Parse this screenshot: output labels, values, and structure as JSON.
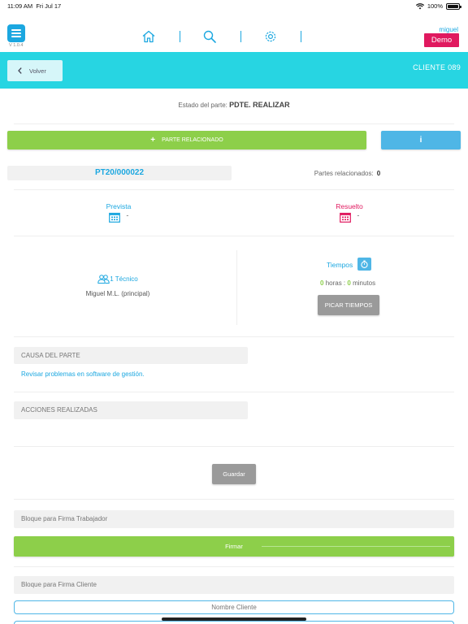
{
  "status_bar": {
    "time": "11:09 AM",
    "date": "Fri Jul 17",
    "battery": "100%"
  },
  "app": {
    "version": "V 1.0.4",
    "user": "miguel",
    "company_badge": "Demo"
  },
  "nav": {
    "icons": [
      "home-icon",
      "search-icon",
      "gear-icon"
    ]
  },
  "header": {
    "back_label": "Volver",
    "client": "CLIENTE 089"
  },
  "estado": {
    "label": "Estado del parte:",
    "value": "PDTE. REALIZAR"
  },
  "actions": {
    "parte_relacionado": "PARTE RELACIONADO",
    "info": "i"
  },
  "parte": {
    "code": "PT20/000022",
    "relacionados_label": "Partes relacionados:",
    "relacionados_count": "0"
  },
  "fechas": {
    "prevista": {
      "label": "Prevista",
      "value": "-"
    },
    "resuelto": {
      "label": "Resuelto",
      "value": "-"
    }
  },
  "tecnicos": {
    "label": "1 Técnico",
    "name": "Miguel M.L. (principal)"
  },
  "tiempos": {
    "label": "Tiempos",
    "horas": "0",
    "horas_label": "horas :",
    "minutos": "0",
    "minutos_label": "minutos",
    "picar": "PICAR TIEMPOS"
  },
  "causa": {
    "label": "CAUSA DEL PARTE",
    "text": "Revisar problemas en software de gestión."
  },
  "acciones": {
    "label": "ACCIONES REALIZADAS"
  },
  "guardar": "Guardar",
  "firma_trabajador": {
    "label": "Bloque para Firma Trabajador",
    "button": "Firmar"
  },
  "firma_cliente": {
    "label": "Bloque para Firma Cliente",
    "placeholder": "Nombre Cliente"
  },
  "colors": {
    "accent": "#1ba7e0",
    "header": "#27d5e2",
    "green": "#8dcf4a",
    "pink": "#e0195f",
    "gray_button": "#9a9a9a"
  }
}
